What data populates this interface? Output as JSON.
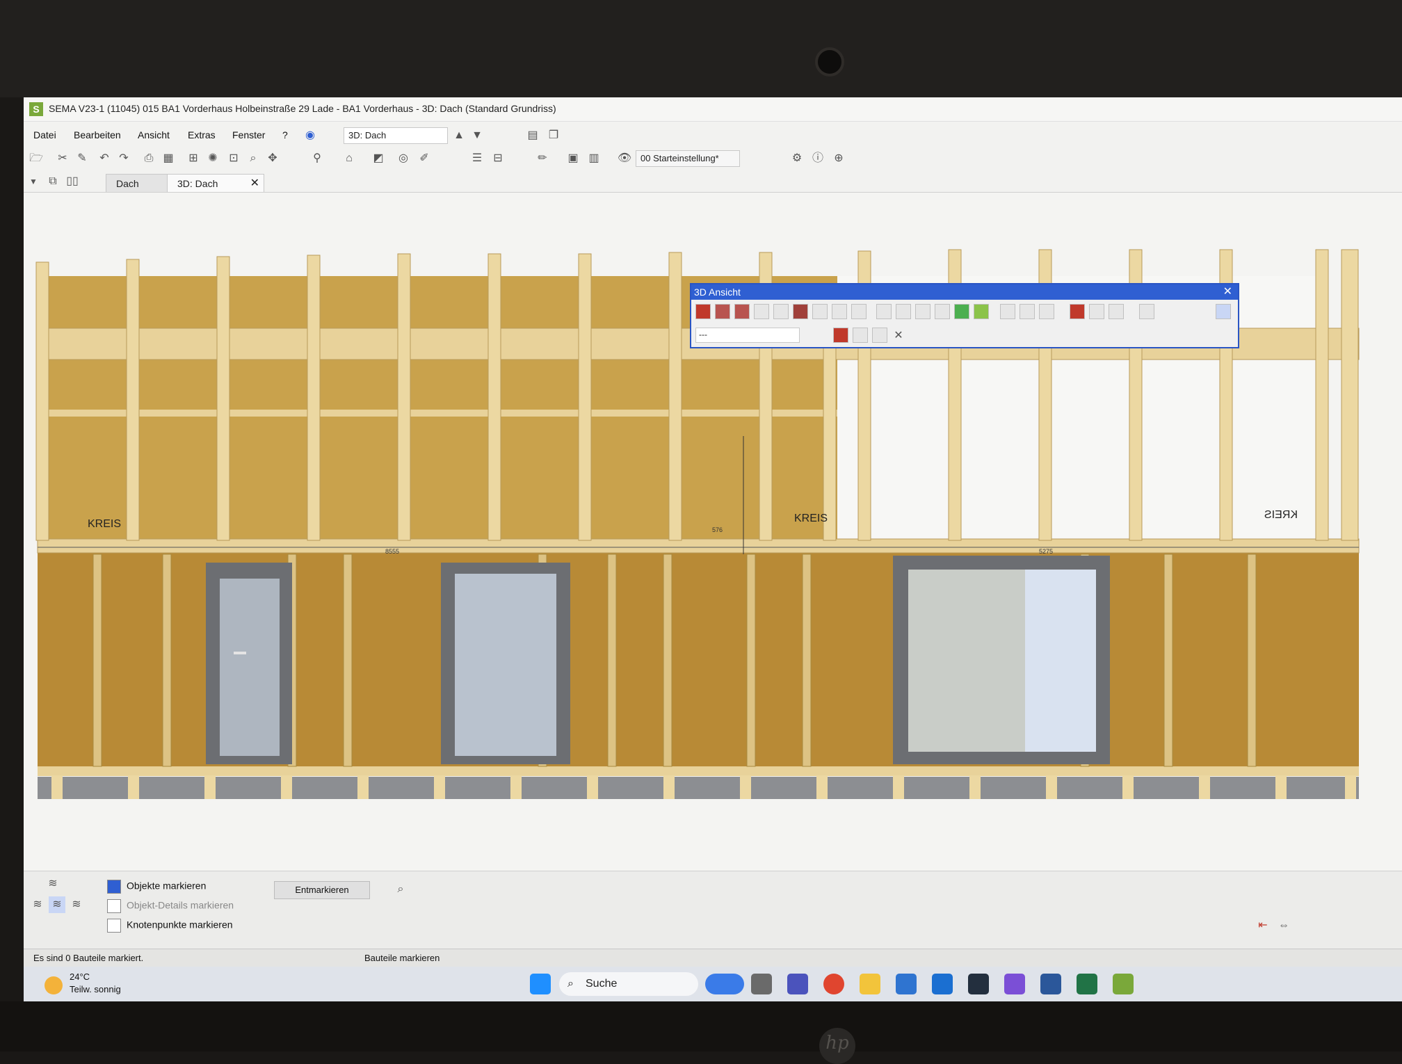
{
  "app": {
    "title": "SEMA V23-1 (11045) 015 BA1 Vorderhaus Holbeinstraße 29 Lade - BA1 Vorderhaus - 3D: Dach (Standard Grundriss)",
    "icon_letter": "S"
  },
  "menu": [
    "Datei",
    "Bearbeiten",
    "Ansicht",
    "Extras",
    "Fenster",
    "?"
  ],
  "view_selector": "3D: Dach",
  "preset_selector": "00 Starteinstellung*",
  "tabs": [
    {
      "label": "Dach",
      "active": false
    },
    {
      "label": "3D: Dach",
      "active": true,
      "close": "✕"
    }
  ],
  "panel_3d": {
    "title": "3D Ansicht",
    "close": "✕",
    "combo_value": "---"
  },
  "viewport_labels": {
    "kreis_left": "KREIS",
    "kreis_mid": "KREIS",
    "kreis_right_mirrored": "KREIS",
    "dim_1": "8555",
    "dim_2": "576",
    "dim_3": "5275"
  },
  "bottom_panel": {
    "option_objects": "Objekte markieren",
    "option_details": "Objekt-Details markieren",
    "option_nodes": "Knotenpunkte markieren",
    "entmarkieren": "Entmarkieren"
  },
  "statusbar": {
    "left": "Es sind 0 Bauteile markiert.",
    "center": "Bauteile markieren"
  },
  "taskbar": {
    "temperature": "24°C",
    "weather": "Teilw. sonnig",
    "search": "Suche"
  },
  "colors": {
    "accent_blue": "#2f5fd2",
    "insulation": "#c9a24c",
    "timber": "#e8d29a",
    "frame_gray": "#6c6e72"
  }
}
